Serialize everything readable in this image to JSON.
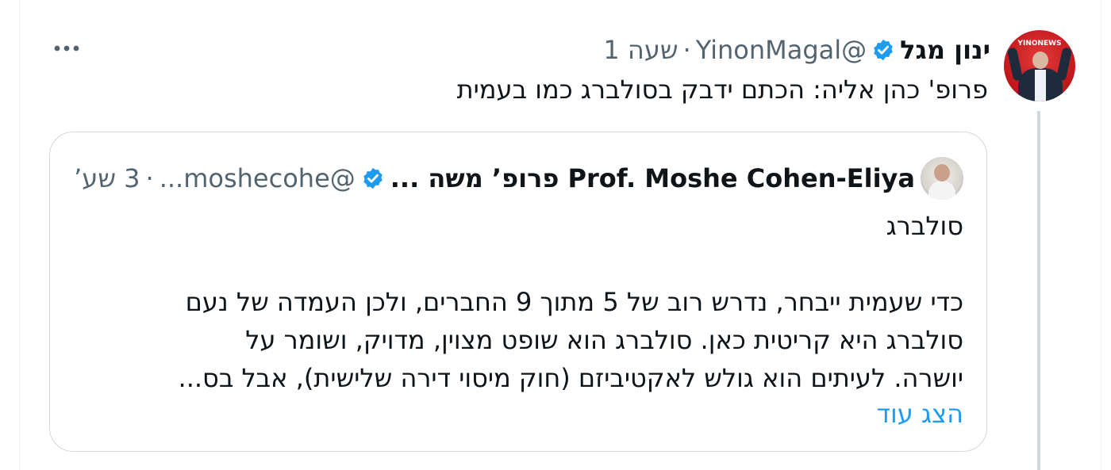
{
  "tweet": {
    "display_name": "ינון מגל",
    "handle": "@YinonMagal",
    "separator": "·",
    "time": "שעה 1",
    "text": "פרופ' כהן אליה: הכתם ידבק בסולברג כמו בעמית",
    "avatar_brand": "YINONEWS",
    "more_icon": "more-horizontal-icon"
  },
  "quote": {
    "display_name": "Prof. Moshe Cohen-Eliya פרופ’ משה ...",
    "handle": "@moshecohe...",
    "separator": "·",
    "time": "3 שע’",
    "body_line1": "סולברג",
    "body_lines": [
      "כדי שעמית ייבחר, נדרש רוב של 5 מתוך 9 החברים, ולכן העמדה של נעם",
      "סולברג היא קריטית כאן. סולברג הוא שופט מצוין, מדויק, ושומר על",
      "יושרה. לעיתים הוא גולש לאקטיביזם (חוק מיסוי דירה שלישית), אבל בס..."
    ],
    "show_more": "הצג עוד"
  },
  "colors": {
    "verified_blue": "#1d9bf0",
    "link_blue": "#1d9bf0",
    "text_primary": "#0f1419",
    "text_secondary": "#536471",
    "border": "#cfd9de"
  },
  "icons": {
    "verified": "verified-badge-icon",
    "more": "more-horizontal-icon"
  }
}
